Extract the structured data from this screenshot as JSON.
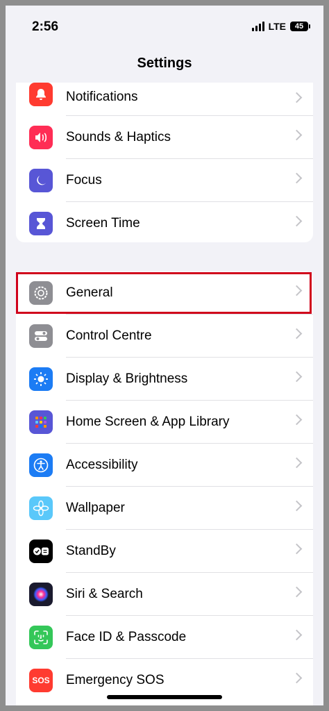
{
  "status": {
    "time": "2:56",
    "network": "LTE",
    "battery": "45"
  },
  "header": {
    "title": "Settings"
  },
  "group1": [
    {
      "label": "Notifications",
      "icon": "bell-icon",
      "color": "#ff3b30"
    },
    {
      "label": "Sounds & Haptics",
      "icon": "speaker-icon",
      "color": "#ff2d55"
    },
    {
      "label": "Focus",
      "icon": "moon-icon",
      "color": "#5856d6"
    },
    {
      "label": "Screen Time",
      "icon": "hourglass-icon",
      "color": "#5856d6"
    }
  ],
  "group2": [
    {
      "label": "General",
      "icon": "gear-icon",
      "color": "#8e8e93"
    },
    {
      "label": "Control Centre",
      "icon": "toggles-icon",
      "color": "#8e8e93"
    },
    {
      "label": "Display & Brightness",
      "icon": "sun-icon",
      "color": "#1c7cf4"
    },
    {
      "label": "Home Screen & App Library",
      "icon": "grid-icon",
      "color": "#5856d6"
    },
    {
      "label": "Accessibility",
      "icon": "accessibility-icon",
      "color": "#1c7cf4"
    },
    {
      "label": "Wallpaper",
      "icon": "flower-icon",
      "color": "#5ac8fa"
    },
    {
      "label": "StandBy",
      "icon": "standby-icon",
      "color": "#000000"
    },
    {
      "label": "Siri & Search",
      "icon": "siri-icon",
      "color": "#1a1a2e"
    },
    {
      "label": "Face ID & Passcode",
      "icon": "face-id-icon",
      "color": "#34c759"
    },
    {
      "label": "Emergency SOS",
      "icon": "sos-icon",
      "color": "#ff3b30",
      "icon_text": "SOS"
    }
  ]
}
